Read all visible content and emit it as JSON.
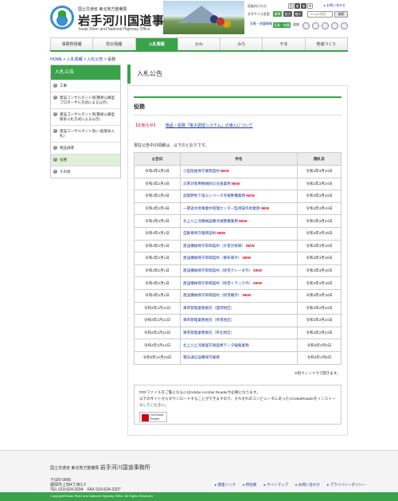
{
  "header": {
    "ministry": "国土交通省 東北地方整備局",
    "office_name": "岩手河川国道事務所",
    "office_en": "Iwate River and National Highway Office.",
    "inquiry": "▸ お問い合わせ",
    "reader_label": "読者向けの方",
    "font_size_label": "文字サイズ変更",
    "search_placeholder": "Google検索",
    "search_button": "検索",
    "btn_ab": "音",
    "btn_1": "あ",
    "btn_2": "あ",
    "btn_3": "中",
    "btn_4": "大",
    "btn_standard": "標準",
    "btn_large": "拡大",
    "btn_small": "縮小",
    "river_info": "気象・地震情報",
    "river_info_btn": "気象・地震",
    "disaster_label": "道路"
  },
  "nav": {
    "items": [
      "事務所情報",
      "防災情報",
      "入札情報",
      "かわ",
      "みち",
      "やま",
      "地域づくり"
    ]
  },
  "breadcrumb": {
    "home": "HOME",
    "sep1": " > ",
    "level1": "入札情報",
    "sep2": " > ",
    "level2": "入札公告",
    "sep3": " > ",
    "current": "役務"
  },
  "sidebar": {
    "title": "入札公告",
    "items": [
      "工事",
      "建設コンサルタント等(簡易公募型プロポーザル方式による公示)",
      "建設コンサルタント等(簡易公募型競争入札方式による公示)",
      "建設コンサルタント等(一般競争入札)",
      "物品調達",
      "役務",
      "その他"
    ]
  },
  "main": {
    "title": "入札公告",
    "section_title": "役務",
    "notice_label": "【お知らせ】",
    "notice_link": "物品・役務「電子調達システム」の導入について",
    "intro": "現在公告中の情報は、以下のとおりです。",
    "table_headers": [
      "公告日",
      "件名",
      "閲札日"
    ],
    "new_label": "NEW",
    "rows": [
      {
        "date": "令和4年2月4日",
        "title": "小型船舶保守業務契約",
        "new": true,
        "close": "令和4年3月24日"
      },
      {
        "date": "令和4年2月4日",
        "title": "災害対策用機械防災支援業務",
        "new": true,
        "close": "令和4年3月24日"
      },
      {
        "date": "令和4年2月4日",
        "title": "加賀野地下道エレベータ点検整備業務",
        "new": true,
        "close": "令和4年3月24日"
      },
      {
        "date": "令和4年2月4日",
        "title": "一関遊水地事業中管理センター監視操作他業務",
        "new": true,
        "close": "令和4年3月24日"
      },
      {
        "date": "令和4年2月4日",
        "title": "北上川上流機械設備点検整備業務",
        "new": true,
        "close": "令和4年3月24日"
      },
      {
        "date": "令和4年2月1日",
        "title": "自動車保守業務契約",
        "new": true,
        "close": "令和4年3月18日"
      },
      {
        "date": "令和4年2月1日",
        "title": "建設機械保守単価契約（災害対策車）",
        "new": true,
        "close": "令和4年3月18日"
      },
      {
        "date": "令和4年2月1日",
        "title": "建設機械保守単価契約（散布車外）",
        "new": true,
        "close": "令和4年3月18日"
      },
      {
        "date": "令和4年2月1日",
        "title": "建設機械保守単価契約（除雪グレーダ外）",
        "new": true,
        "close": "令和4年3月18日"
      },
      {
        "date": "令和4年2月1日",
        "title": "建設機械保守単価契約（除雪トラック外）",
        "new": true,
        "close": "令和4年3月18日"
      },
      {
        "date": "令和4年2月1日",
        "title": "建設機械保守単価契約（除雪機外）",
        "new": true,
        "close": "令和4年3月18日"
      },
      {
        "date": "令和4年1月21日",
        "title": "車両管理業務委託（盛岡地区）",
        "new": false,
        "close": "令和4年2月24日"
      },
      {
        "date": "令和4年1月21日",
        "title": "車両管理業務委託（県南地区）",
        "new": false,
        "close": "令和4年2月24日"
      },
      {
        "date": "令和4年1月21日",
        "title": "車両管理業務委託（県北地区）",
        "new": false,
        "close": "令和4年2月24日"
      },
      {
        "date": "令和4年1月14日",
        "title": "北上川上流集塩写真画像データ編集業務",
        "new": false,
        "close": "令和4年2月2日"
      },
      {
        "date": "令和3年12月23日",
        "title": "電気通信設備保守業務",
        "new": false,
        "close": "令和4年1月5日"
      }
    ],
    "newwin_note": "※別ウィンドウで開きます。",
    "pdf_line1": "PDFファイルをご覧になるにはAdobe Acrobat Readerが必要になります。",
    "pdf_line2": "以下のサイトからダウンロードすることができますので、それぞれのコンピュータにあったAcrobatReaderをインストールしてください。",
    "adobe_badge": "Get Adobe Reader"
  },
  "footer": {
    "org": "国土交通省 東北地方整備局",
    "name": "岩手河川国道事務所",
    "zip": "〒020-0066",
    "address": "盛岡市上田4丁目2-2",
    "tel": "TEL 019-624-3204　FAX 019-624-3207",
    "links": [
      "▸ 関連リンク",
      "▸ 所窓務",
      "▸ サイトマップ",
      "▸ お問い合わせ",
      "▸ プライバシーポリシー"
    ],
    "copyright": "Copyright©Iwate River and National Highway Office. All Rights Reserved."
  },
  "colors": {
    "accent": "#3aa34a",
    "new_red": "#e0001b",
    "link": "#1a3a9c"
  }
}
